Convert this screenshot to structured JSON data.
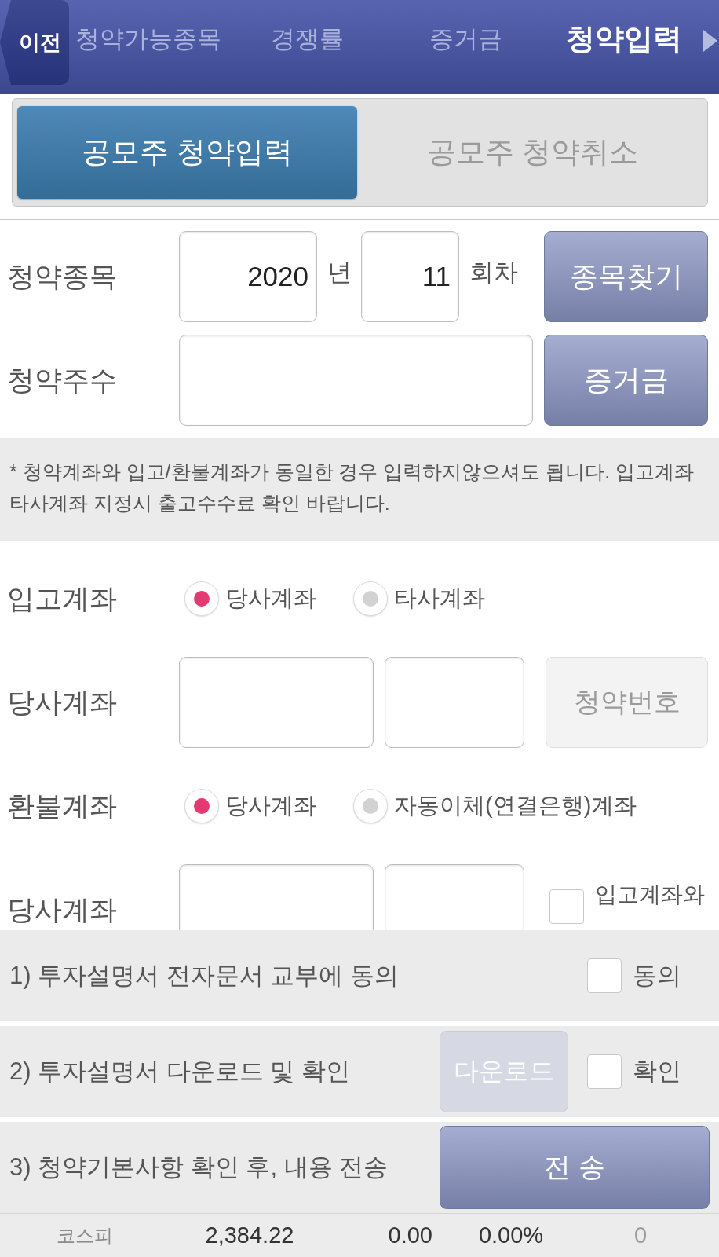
{
  "header": {
    "back_button": "이전",
    "tabs": [
      {
        "label": "청약가능종목",
        "selected": false
      },
      {
        "label": "경쟁률",
        "selected": false
      },
      {
        "label": "증거금",
        "selected": false
      },
      {
        "label": "청약입력",
        "selected": true
      }
    ]
  },
  "segments": [
    {
      "label": "공모주 청약입력",
      "selected": true
    },
    {
      "label": "공모주 청약취소",
      "selected": false
    }
  ],
  "form_rows": [
    {
      "kind": "issue",
      "label": "청약종목",
      "year": "2020",
      "year_unit": "년",
      "round": "11",
      "round_unit": "회차",
      "button": "종목찾기"
    },
    {
      "kind": "shares",
      "label": "청약주수",
      "button": "증거금"
    },
    {
      "kind": "notice",
      "text": "* 청약계좌와 입고/환불계좌가 동일한 경우 입력하지않으셔도 됩니다. 입고계좌 타사계좌 지정시 출고수수료 확인 바랍니다."
    },
    {
      "kind": "radio",
      "label": "입고계좌",
      "options": [
        {
          "label": "당사계좌",
          "selected": true
        },
        {
          "label": "타사계좌",
          "selected": false
        }
      ]
    },
    {
      "kind": "account",
      "label": "당사계좌",
      "button": "청약번호",
      "button_disabled": true
    },
    {
      "kind": "radio",
      "label": "환불계좌",
      "options": [
        {
          "label": "당사계좌",
          "selected": true
        },
        {
          "label": "자동이체(연결은행)계좌",
          "selected": false
        }
      ]
    },
    {
      "kind": "account",
      "label": "당사계좌",
      "same_as_deposit": {
        "label": "입고계좌와",
        "checked": false
      }
    }
  ],
  "steps": [
    {
      "kind": "check",
      "label": "1) 투자설명서 전자문서 교부에 동의",
      "check": {
        "label": "동의",
        "checked": false
      }
    },
    {
      "kind": "download_check",
      "label": "2) 투자설명서 다운로드 및 확인",
      "button": "다운로드",
      "button_disabled": true,
      "check": {
        "label": "확인",
        "checked": false
      }
    },
    {
      "kind": "submit",
      "label": "3) 청약기본사항 확인 후, 내용 전송",
      "button": "전 송"
    }
  ],
  "ticker": {
    "index_name": "코스피",
    "value": "2,384.22",
    "change": "0.00",
    "change_rate": "0.00%",
    "volume": "0"
  }
}
